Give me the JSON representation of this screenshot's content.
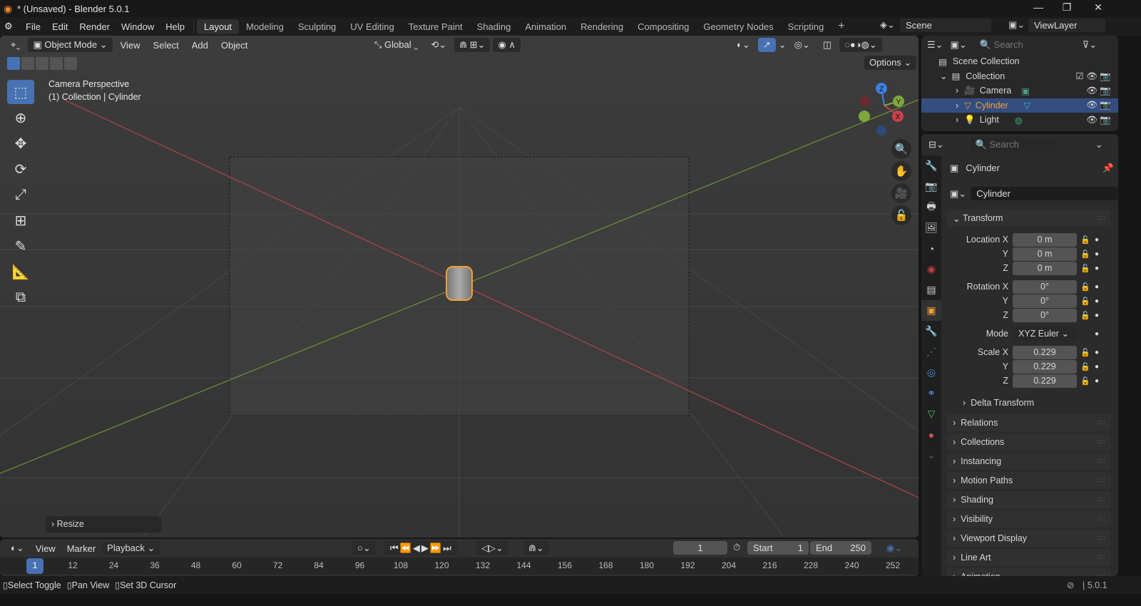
{
  "window": {
    "title": "* (Unsaved) - Blender 5.0.1",
    "minimize": "—",
    "maximize": "❐",
    "close": "✕"
  },
  "menu": {
    "items": [
      "File",
      "Edit",
      "Render",
      "Window",
      "Help"
    ]
  },
  "workspaces": [
    "Layout",
    "Modeling",
    "Sculpting",
    "UV Editing",
    "Texture Paint",
    "Shading",
    "Animation",
    "Rendering",
    "Compositing",
    "Geometry Nodes",
    "Scripting"
  ],
  "workspace_add": "+",
  "scene": {
    "name": "Scene",
    "view_layer": "ViewLayer"
  },
  "viewport": {
    "mode": "Object Mode",
    "menus": [
      "View",
      "Select",
      "Add",
      "Object"
    ],
    "orientation": "Global",
    "options": "Options",
    "overlay_title": "Camera Perspective",
    "overlay_sub": "(1) Collection | Cylinder",
    "last_op": "Resize",
    "gizmo": {
      "x": "X",
      "y": "Y",
      "z": "Z"
    }
  },
  "outliner": {
    "search_placeholder": "Search",
    "scene_collection": "Scene Collection",
    "collection": "Collection",
    "items": [
      {
        "name": "Camera",
        "selected": false,
        "color": "#e0a050"
      },
      {
        "name": "Cylinder",
        "selected": true,
        "color": "#f0a040"
      },
      {
        "name": "Light",
        "selected": false,
        "color": "#e0a050"
      }
    ]
  },
  "properties": {
    "search_placeholder": "Search",
    "object_name": "Cylinder",
    "data_name": "Cylinder",
    "transform": "Transform",
    "location": {
      "label": "Location X",
      "x": "0 m",
      "y": "0 m",
      "z": "0 m"
    },
    "rotation": {
      "label": "Rotation X",
      "x": "0°",
      "y": "0°",
      "z": "0°"
    },
    "mode": {
      "label": "Mode",
      "value": "XYZ Euler"
    },
    "scale": {
      "label": "Scale X",
      "x": "0.229",
      "y": "0.229",
      "z": "0.229"
    },
    "axis": {
      "y": "Y",
      "z": "Z"
    },
    "delta": "Delta Transform",
    "panels": [
      "Relations",
      "Collections",
      "Instancing",
      "Motion Paths",
      "Shading",
      "Visibility",
      "Viewport Display",
      "Line Art",
      "Animation"
    ]
  },
  "timeline": {
    "menus": [
      "View",
      "Marker",
      "Playback"
    ],
    "current_frame": "1",
    "start_label": "Start",
    "start": "1",
    "end_label": "End",
    "end": "250",
    "ticks": [
      "1",
      "12",
      "24",
      "36",
      "48",
      "60",
      "72",
      "84",
      "96",
      "108",
      "120",
      "132",
      "144",
      "156",
      "168",
      "180",
      "192",
      "204",
      "216",
      "228",
      "240",
      "252"
    ]
  },
  "status": {
    "items": [
      "Select Toggle",
      "Pan View",
      "Set 3D Cursor"
    ],
    "version": "5.0.1"
  },
  "colors": {
    "accent": "#4772b3",
    "selected_row": "#334d80",
    "x_axis": "#c8404a",
    "y_axis": "#7ea63a",
    "z_axis": "#3d7ee0",
    "object_outline": "#f0a030"
  }
}
